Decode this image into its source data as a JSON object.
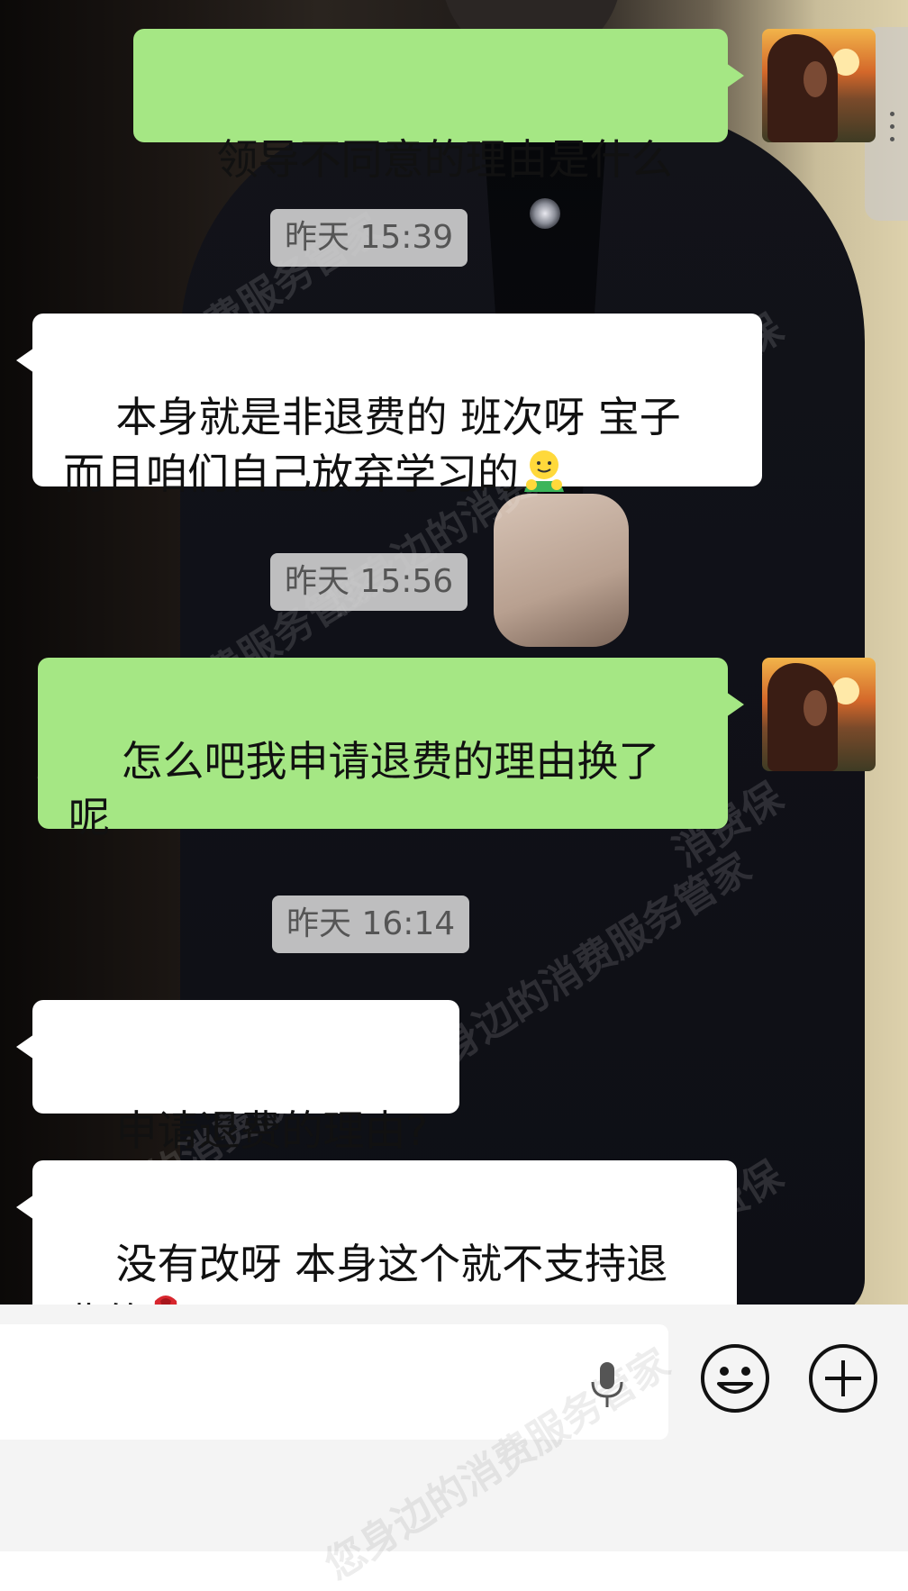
{
  "watermark": "您身边的消费服务管家",
  "watermark_short": "消费保",
  "messages": [
    {
      "type": "out",
      "text": "领导不同意的理由是什么"
    },
    {
      "type": "time",
      "text": "昨天 15:39"
    },
    {
      "type": "in",
      "text": "本身就是非退费的 班次呀 宝子\n而且咱们自己放弃学习的",
      "emoji": "hugging-face-emoji"
    },
    {
      "type": "time",
      "text": "昨天 15:56"
    },
    {
      "type": "out",
      "text": "怎么吧我申请退费的理由换了\n呢"
    },
    {
      "type": "time",
      "text": "昨天 16:14"
    },
    {
      "type": "in",
      "text": "申请退费的理由?"
    },
    {
      "type": "in",
      "text": "没有改呀 本身这个就不支持退\n费的",
      "emoji": "rose-emoji"
    }
  ],
  "input": {
    "value": "",
    "mic_icon": "microphone-icon",
    "emoji_icon": "smiley-icon",
    "plus_icon": "plus-circle-icon"
  },
  "colors": {
    "outgoing_bubble": "#a5e784",
    "incoming_bubble": "#ffffff",
    "timestamp_bg": "#d2d2d2",
    "input_bar": "#f4f4f4"
  }
}
